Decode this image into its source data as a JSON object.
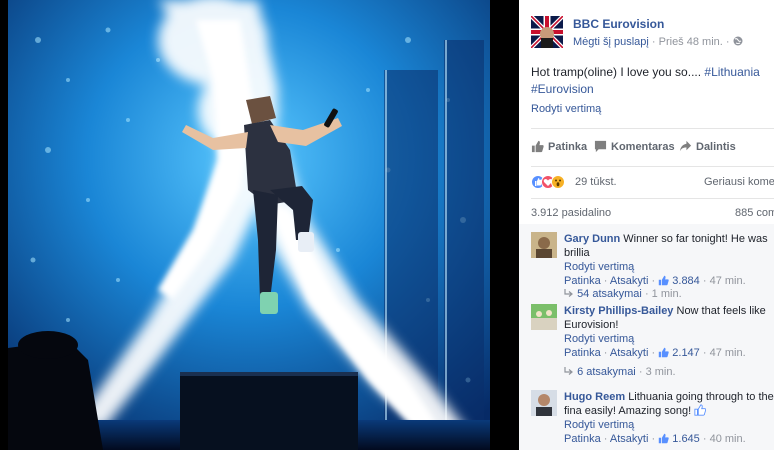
{
  "page": {
    "name": "BBC Eurovision",
    "like_page": "Mėgti šį puslapį",
    "time": "Prieš 48 min."
  },
  "post": {
    "text": "Hot tramp(oline) I love you so.... ",
    "hashtag1": "#Lithuania",
    "hashtag2": "#Eurovision",
    "translate": "Rodyti vertimą"
  },
  "actions": {
    "like": "Patinka",
    "comment": "Komentaras",
    "share": "Dalintis"
  },
  "reactions": {
    "count": "29 tūkst.",
    "sort": "Geriausi koment"
  },
  "shares": {
    "count": "3.912 pasidalino",
    "views": "885 com"
  },
  "comments": [
    {
      "name": "Gary Dunn",
      "text": "Winner so far tonight! He was brillia",
      "translate": "Rodyti vertimą",
      "like": "Patinka",
      "reply": "Atsakyti",
      "likes": "3.884",
      "time": "47 min.",
      "replies": "54 atsakymai",
      "replies_time": "1 min."
    },
    {
      "name": "Kirsty Phillips-Bailey",
      "text": "Now that feels like Eurovision!",
      "translate": "Rodyti vertimą",
      "like": "Patinka",
      "reply": "Atsakyti",
      "likes": "2.147",
      "time": "47 min.",
      "replies": "6 atsakymai",
      "replies_time": "3 min."
    },
    {
      "name": "Hugo Reem",
      "text": "Lithuania going through to the fina easily! Amazing song!",
      "translate": "Rodyti vertimą",
      "like": "Patinka",
      "reply": "Atsakyti",
      "likes": "1.645",
      "time": "40 min."
    }
  ],
  "separator": "·",
  "icons": {
    "globe": "globe-icon",
    "like": "thumbs-up-icon",
    "comment": "speech-bubble-icon",
    "share": "share-arrow-icon",
    "reply_thread": "reply-arrow-icon"
  },
  "colors": {
    "link": "#365899",
    "meta": "#90949c",
    "stage_blue": "#1e7fd0",
    "fb_like": "#5890ff",
    "love": "#f25268",
    "wow": "#f7b125"
  }
}
